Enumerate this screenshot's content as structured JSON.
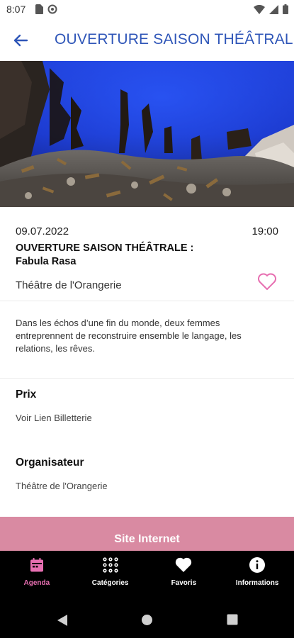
{
  "status_bar": {
    "time": "8:07",
    "icons": [
      "sim-card-icon",
      "data-saver-icon",
      "wifi-icon",
      "signal-icon",
      "battery-icon"
    ]
  },
  "app_bar": {
    "back_icon": "arrow-left-icon",
    "title": "OUVERTURE SAISON THÉÂTRALE : Fabula Rasa",
    "title_color": "#2f56b8"
  },
  "event": {
    "date": "09.07.2022",
    "time": "19:00",
    "title_line1": "OUVERTURE SAISON THÉÂTRALE :",
    "title_line2": "Fabula Rasa",
    "venue": "Théâtre de l'Orangerie",
    "favorite_icon": "heart-outline-icon",
    "description": "Dans les échos d’une fin du monde, deux femmes entreprennent de reconstruire ensemble le langage, les relations, les rêves."
  },
  "details": {
    "price_title": "Prix",
    "price_value": "Voir Lien Billetterie",
    "organizer_title": "Organisateur",
    "organizer_value": "Théâtre de l'Orangerie"
  },
  "website_button": {
    "label": "Site Internet",
    "color": "#d98aa2"
  },
  "bottom_nav": {
    "items": [
      {
        "label": "Agenda",
        "icon": "calendar-icon",
        "active": true
      },
      {
        "label": "Catégories",
        "icon": "grid-icon",
        "active": false
      },
      {
        "label": "Favoris",
        "icon": "heart-icon",
        "active": false
      },
      {
        "label": "Informations",
        "icon": "info-icon",
        "active": false
      }
    ],
    "active_color": "#e76fb1"
  },
  "system_nav": {
    "icons": [
      "back-triangle-icon",
      "home-circle-icon",
      "recents-square-icon"
    ]
  }
}
